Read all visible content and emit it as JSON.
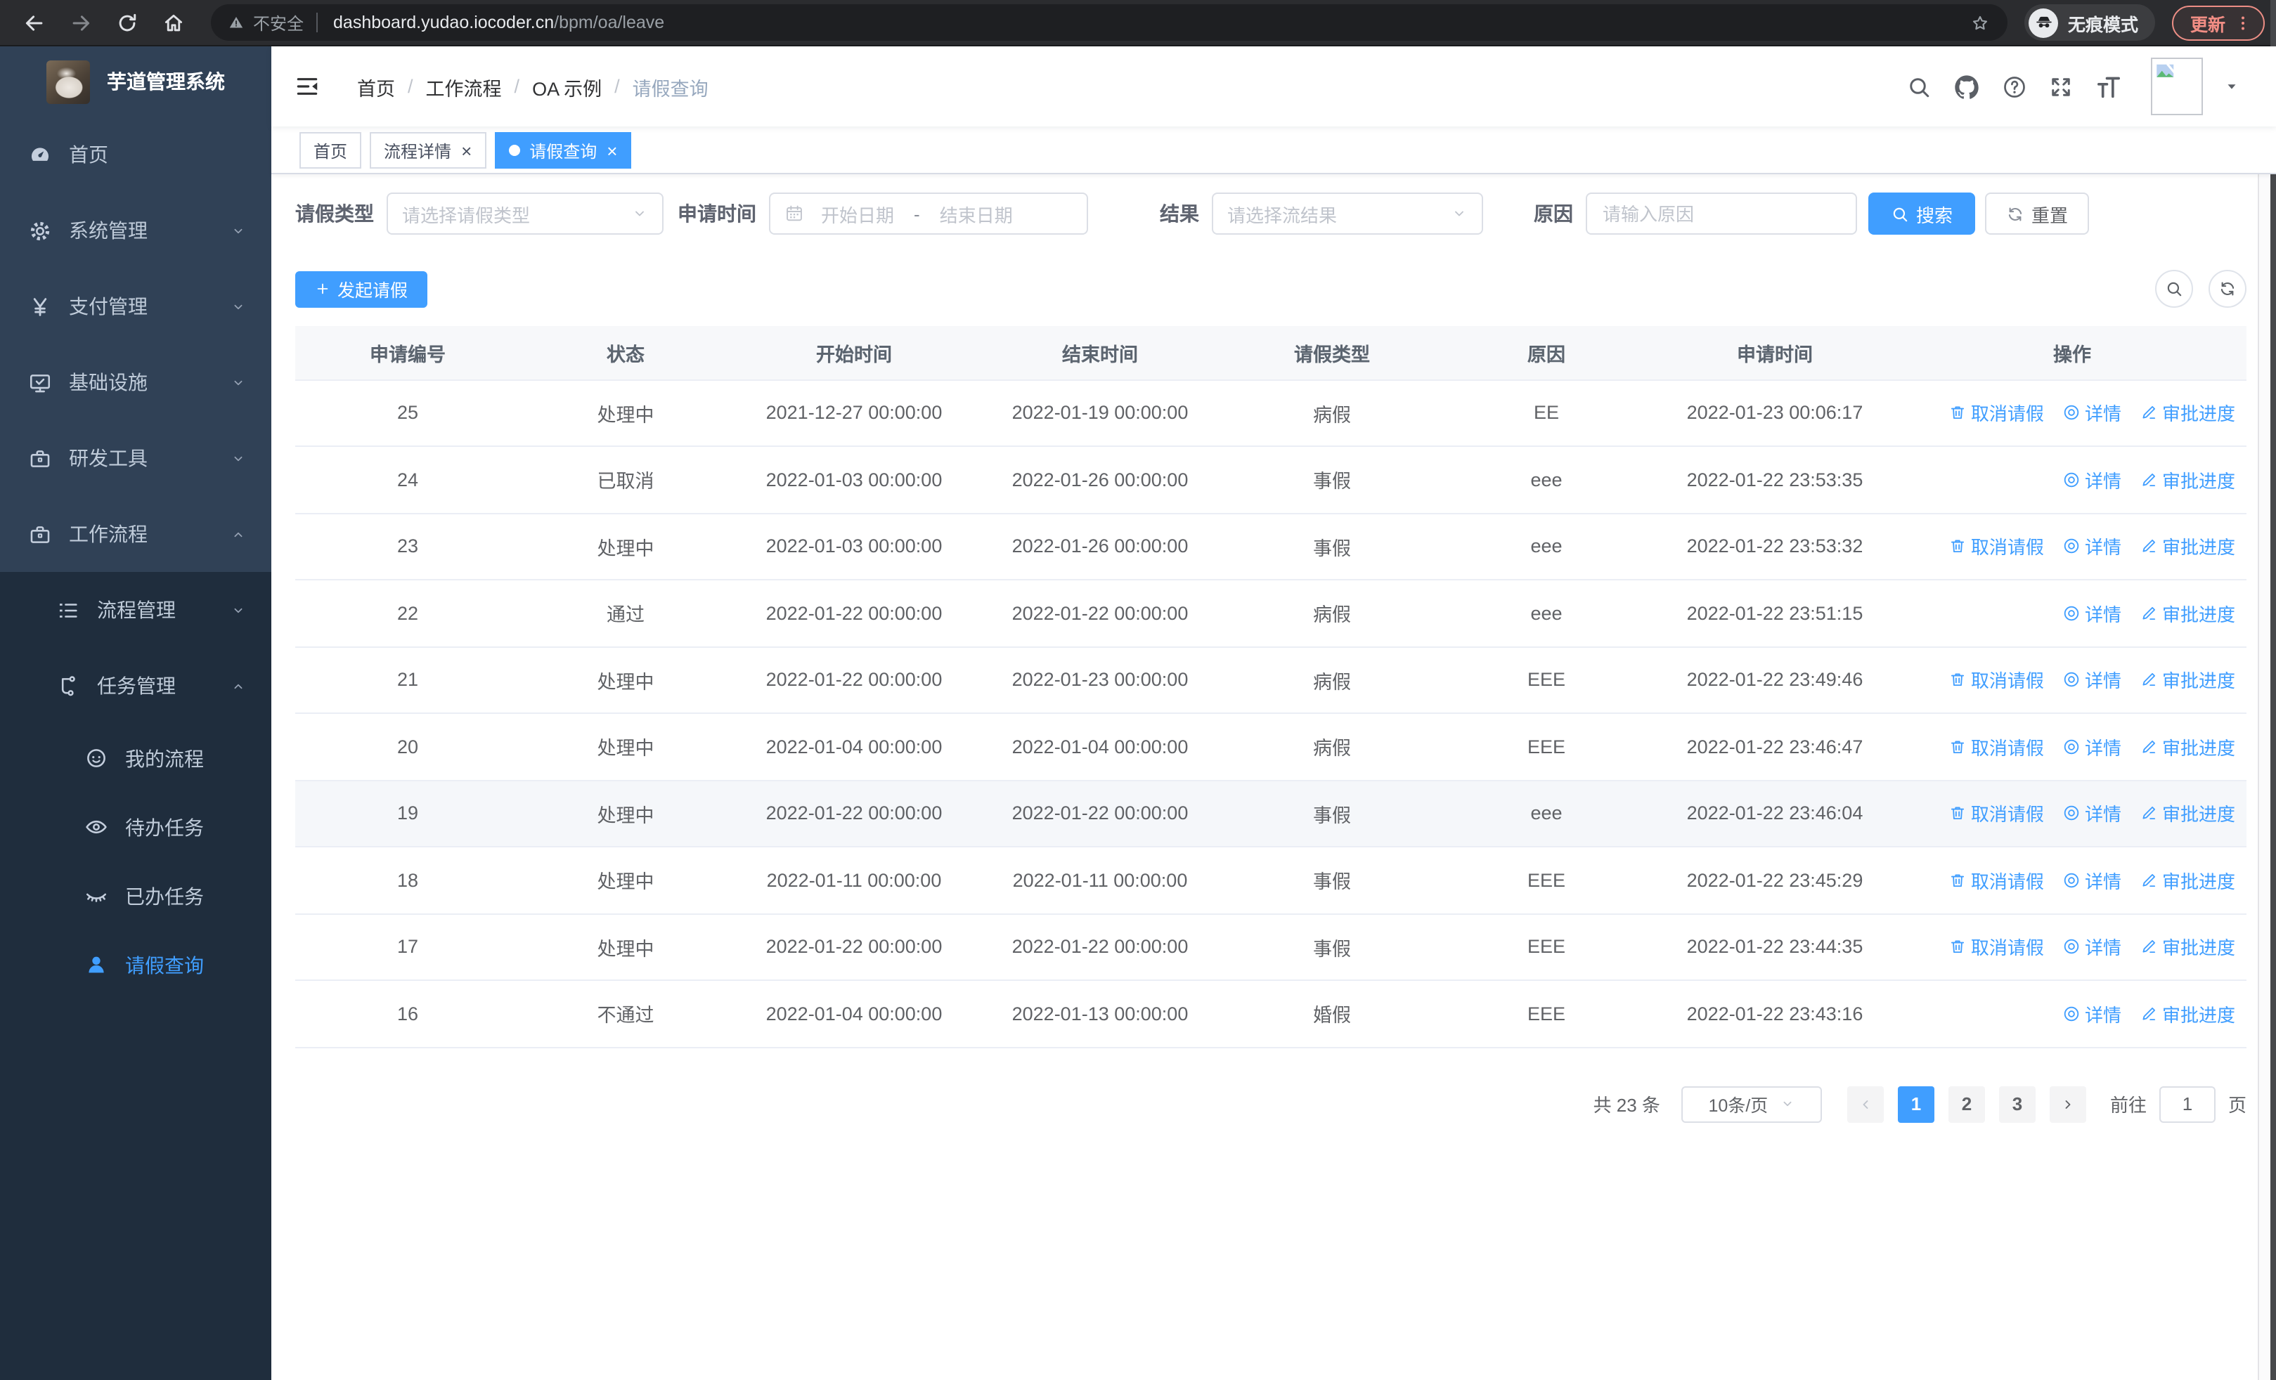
{
  "browser": {
    "security_label": "不安全",
    "url_host": "dashboard.yudao.iocoder.cn",
    "url_path": "/bpm/oa/leave",
    "incognito_label": "无痕模式",
    "update_label": "更新"
  },
  "sidebar": {
    "title": "芋道管理系统",
    "items": [
      {
        "key": "home",
        "label": "首页",
        "icon": "dashboard",
        "level": 0
      },
      {
        "key": "system",
        "label": "系统管理",
        "icon": "gear",
        "level": 0,
        "chevron": "down"
      },
      {
        "key": "payment",
        "label": "支付管理",
        "icon": "yen",
        "level": 0,
        "chevron": "down"
      },
      {
        "key": "infra",
        "label": "基础设施",
        "icon": "monitor",
        "level": 0,
        "chevron": "down"
      },
      {
        "key": "devtools",
        "label": "研发工具",
        "icon": "briefcase",
        "level": 0,
        "chevron": "down"
      },
      {
        "key": "workflow",
        "label": "工作流程",
        "icon": "briefcase",
        "level": 0,
        "chevron": "up"
      },
      {
        "key": "process-mgmt",
        "label": "流程管理",
        "icon": "list",
        "level": 1,
        "chevron": "down"
      },
      {
        "key": "task-mgmt",
        "label": "任务管理",
        "icon": "tree",
        "level": 1,
        "chevron": "up"
      },
      {
        "key": "my-process",
        "label": "我的流程",
        "icon": "face",
        "level": 2
      },
      {
        "key": "todo-tasks",
        "label": "待办任务",
        "icon": "eye",
        "level": 2
      },
      {
        "key": "done-tasks",
        "label": "已办任务",
        "icon": "eye-closed",
        "level": 2
      },
      {
        "key": "leave-query",
        "label": "请假查询",
        "icon": "user",
        "level": 2,
        "active": true
      }
    ]
  },
  "header": {
    "breadcrumb": [
      "首页",
      "工作流程",
      "OA 示例",
      "请假查询"
    ],
    "breadcrumb_separator": "/"
  },
  "tabs": [
    {
      "key": "home",
      "label": "首页",
      "closable": false,
      "active": false
    },
    {
      "key": "process-detail",
      "label": "流程详情",
      "closable": true,
      "active": false
    },
    {
      "key": "leave-query",
      "label": "请假查询",
      "closable": true,
      "active": true
    }
  ],
  "filters": {
    "type_label": "请假类型",
    "type_placeholder": "请选择请假类型",
    "time_label": "申请时间",
    "start_placeholder": "开始日期",
    "range_separator": "-",
    "end_placeholder": "结束日期",
    "result_label": "结果",
    "result_placeholder": "请选择流结果",
    "reason_label": "原因",
    "reason_placeholder": "请输入原因",
    "search_label": "搜索",
    "reset_label": "重置"
  },
  "toolbar": {
    "create_label": "发起请假"
  },
  "table": {
    "columns": [
      "申请编号",
      "状态",
      "开始时间",
      "结束时间",
      "请假类型",
      "原因",
      "申请时间",
      "操作"
    ],
    "action_labels": {
      "cancel": "取消请假",
      "detail": "详情",
      "progress": "审批进度"
    },
    "rows": [
      {
        "id": "25",
        "status": "处理中",
        "start": "2021-12-27 00:00:00",
        "end": "2022-01-19 00:00:00",
        "type": "病假",
        "reason": "EE",
        "apply": "2022-01-23 00:06:17",
        "actions": [
          "cancel",
          "detail",
          "progress"
        ],
        "highlight": false
      },
      {
        "id": "24",
        "status": "已取消",
        "start": "2022-01-03 00:00:00",
        "end": "2022-01-26 00:00:00",
        "type": "事假",
        "reason": "eee",
        "apply": "2022-01-22 23:53:35",
        "actions": [
          "detail",
          "progress"
        ],
        "highlight": false
      },
      {
        "id": "23",
        "status": "处理中",
        "start": "2022-01-03 00:00:00",
        "end": "2022-01-26 00:00:00",
        "type": "事假",
        "reason": "eee",
        "apply": "2022-01-22 23:53:32",
        "actions": [
          "cancel",
          "detail",
          "progress"
        ],
        "highlight": false
      },
      {
        "id": "22",
        "status": "通过",
        "start": "2022-01-22 00:00:00",
        "end": "2022-01-22 00:00:00",
        "type": "病假",
        "reason": "eee",
        "apply": "2022-01-22 23:51:15",
        "actions": [
          "detail",
          "progress"
        ],
        "highlight": false
      },
      {
        "id": "21",
        "status": "处理中",
        "start": "2022-01-22 00:00:00",
        "end": "2022-01-23 00:00:00",
        "type": "病假",
        "reason": "EEE",
        "apply": "2022-01-22 23:49:46",
        "actions": [
          "cancel",
          "detail",
          "progress"
        ],
        "highlight": false
      },
      {
        "id": "20",
        "status": "处理中",
        "start": "2022-01-04 00:00:00",
        "end": "2022-01-04 00:00:00",
        "type": "病假",
        "reason": "EEE",
        "apply": "2022-01-22 23:46:47",
        "actions": [
          "cancel",
          "detail",
          "progress"
        ],
        "highlight": false
      },
      {
        "id": "19",
        "status": "处理中",
        "start": "2022-01-22 00:00:00",
        "end": "2022-01-22 00:00:00",
        "type": "事假",
        "reason": "eee",
        "apply": "2022-01-22 23:46:04",
        "actions": [
          "cancel",
          "detail",
          "progress"
        ],
        "highlight": true
      },
      {
        "id": "18",
        "status": "处理中",
        "start": "2022-01-11 00:00:00",
        "end": "2022-01-11 00:00:00",
        "type": "事假",
        "reason": "EEE",
        "apply": "2022-01-22 23:45:29",
        "actions": [
          "cancel",
          "detail",
          "progress"
        ],
        "highlight": false
      },
      {
        "id": "17",
        "status": "处理中",
        "start": "2022-01-22 00:00:00",
        "end": "2022-01-22 00:00:00",
        "type": "事假",
        "reason": "EEE",
        "apply": "2022-01-22 23:44:35",
        "actions": [
          "cancel",
          "detail",
          "progress"
        ],
        "highlight": false
      },
      {
        "id": "16",
        "status": "不通过",
        "start": "2022-01-04 00:00:00",
        "end": "2022-01-13 00:00:00",
        "type": "婚假",
        "reason": "EEE",
        "apply": "2022-01-22 23:43:16",
        "actions": [
          "detail",
          "progress"
        ],
        "highlight": false
      }
    ]
  },
  "pagination": {
    "total_label": "共 23 条",
    "page_size_label": "10条/页",
    "pages": [
      "1",
      "2",
      "3"
    ],
    "active_page": "1",
    "goto_label": "前往",
    "goto_value": "1",
    "page_unit_label": "页"
  },
  "colors": {
    "primary": "#409eff",
    "sidebar_bg": "#304156",
    "submenu_bg": "#1f2d3d",
    "update_accent": "#f18d84",
    "table_border": "#ebeef5"
  }
}
